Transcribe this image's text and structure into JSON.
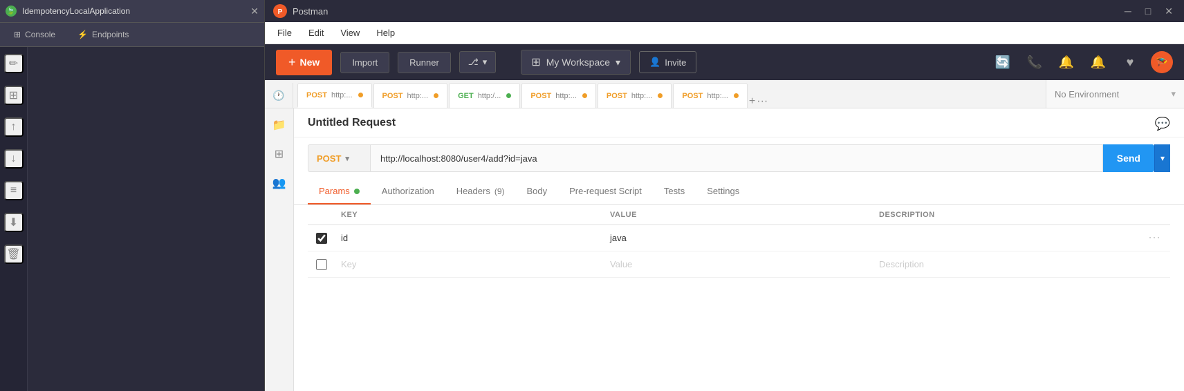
{
  "ide": {
    "title": "IdempotencyLocalApplication",
    "tabs": [
      {
        "id": "console",
        "label": "Console",
        "icon": "⊞"
      },
      {
        "id": "endpoints",
        "label": "Endpoints",
        "icon": "⚡"
      }
    ],
    "icons": [
      "✏️",
      "⊞",
      "↑",
      "↓",
      "≡",
      "⊕",
      "⊖"
    ]
  },
  "titlebar": {
    "app_name": "Postman",
    "logo_color": "#f05a28"
  },
  "menu": {
    "items": [
      "File",
      "Edit",
      "View",
      "Help"
    ]
  },
  "toolbar": {
    "new_label": "New",
    "import_label": "Import",
    "runner_label": "Runner",
    "workspace_label": "My Workspace",
    "invite_label": "Invite",
    "new_icon": "+"
  },
  "environment": {
    "label": "No Environment"
  },
  "tabs": [
    {
      "method": "POST",
      "url": "http:...",
      "dot": true,
      "active": true
    },
    {
      "method": "POST",
      "url": "http:...",
      "dot": true,
      "active": false
    },
    {
      "method": "GET",
      "url": "http:...",
      "dot": true,
      "active": false
    },
    {
      "method": "POST",
      "url": "http:...",
      "dot": true,
      "active": false
    },
    {
      "method": "POST",
      "url": "http:...",
      "dot": true,
      "active": false
    },
    {
      "method": "POST",
      "url": "http:...",
      "dot": true,
      "active": false
    }
  ],
  "request": {
    "title": "Untitled Request",
    "method": "POST",
    "url": "http://localhost:8080/user4/add?id=java",
    "send_label": "Send",
    "tabs": [
      {
        "id": "params",
        "label": "Params",
        "badge": "dot",
        "active": true
      },
      {
        "id": "authorization",
        "label": "Authorization",
        "active": false
      },
      {
        "id": "headers",
        "label": "Headers",
        "count": "(9)",
        "active": false
      },
      {
        "id": "body",
        "label": "Body",
        "active": false
      },
      {
        "id": "pre-request",
        "label": "Pre-request Script",
        "active": false
      },
      {
        "id": "tests",
        "label": "Tests",
        "active": false
      },
      {
        "id": "settings",
        "label": "Settings",
        "active": false
      }
    ],
    "table": {
      "columns": [
        "",
        "KEY",
        "VALUE",
        "DESCRIPTION",
        ""
      ],
      "rows": [
        {
          "checked": true,
          "key": "id",
          "value": "java",
          "description": ""
        },
        {
          "checked": false,
          "key": "",
          "value": "",
          "description": "",
          "placeholder_key": "Key",
          "placeholder_value": "Value",
          "placeholder_desc": "Description"
        }
      ]
    }
  }
}
